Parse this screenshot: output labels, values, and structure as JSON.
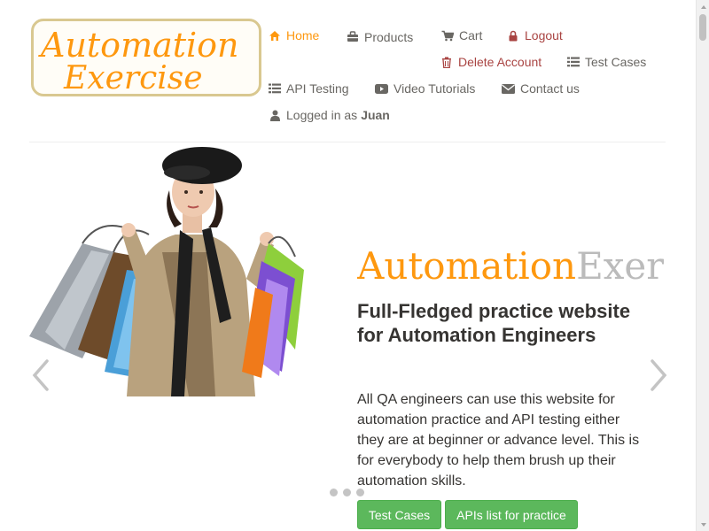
{
  "logo": {
    "line1": "Automation",
    "line2": "Exercise"
  },
  "nav": {
    "home": "Home",
    "products": "Products",
    "cart": "Cart",
    "logout": "Logout",
    "delete_account": "Delete Account",
    "test_cases": "Test Cases",
    "api_testing": "API Testing",
    "video_tutorials": "Video Tutorials",
    "contact_us": "Contact us",
    "logged_in_prefix": "Logged in as",
    "username": "Juan"
  },
  "hero": {
    "title_part1": "Automation",
    "title_part2": "Exercise",
    "subtitle": "Full-Fledged practice website for Automation Engineers",
    "description": "All QA engineers can use this website for automation practice and API testing either they are at beginner or advance level. This is for everybody to help them brush up their automation skills.",
    "btn_test_cases": "Test Cases",
    "btn_apis": "APIs list for practice"
  },
  "colors": {
    "accent": "#fe980f",
    "danger": "#a94442",
    "button": "#5cb85c"
  },
  "icons": {
    "home": "home-icon",
    "products": "shopping-bag-icon",
    "cart": "cart-icon",
    "logout": "lock-icon",
    "delete": "trash-icon",
    "test_cases": "list-icon",
    "api": "list-icon",
    "video": "youtube-play-icon",
    "contact": "envelope-icon",
    "user": "user-icon"
  }
}
